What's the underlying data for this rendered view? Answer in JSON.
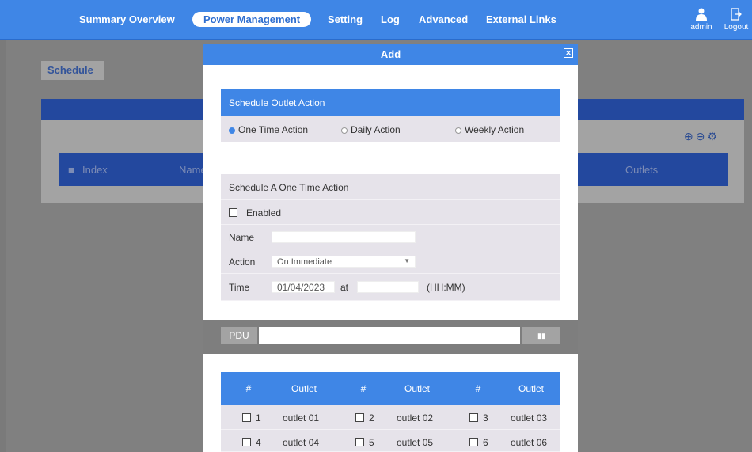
{
  "nav": {
    "items": [
      "Summary Overview",
      "Power Management",
      "Setting",
      "Log",
      "Advanced",
      "External Links"
    ],
    "active": "Power Management",
    "user_label": "admin",
    "logout_label": "Logout"
  },
  "background": {
    "tab_label": "Schedule",
    "columns": [
      "Index",
      "Name",
      "Outlets"
    ]
  },
  "modal": {
    "title": "Add",
    "section_title": "Schedule Outlet Action",
    "radios": [
      {
        "label": "One Time Action",
        "selected": true
      },
      {
        "label": "Daily Action",
        "selected": false
      },
      {
        "label": "Weekly Action",
        "selected": false
      }
    ],
    "sub_title": "Schedule A One Time Action",
    "enabled_label": "Enabled",
    "name_label": "Name",
    "name_value": "",
    "action_label": "Action",
    "action_value": "On Immediate",
    "time_label": "Time",
    "date_value": "01/04/2023",
    "at_label": "at",
    "time_value": "",
    "time_hint": "(HH:MM)",
    "pdu_label": "PDU",
    "pdu_value": "",
    "outlet_headers": [
      "#",
      "Outlet",
      "#",
      "Outlet",
      "#",
      "Outlet"
    ],
    "outlets": [
      [
        "1",
        "outlet 01",
        "2",
        "outlet 02",
        "3",
        "outlet 03"
      ],
      [
        "4",
        "outlet 04",
        "5",
        "outlet 05",
        "6",
        "outlet 06"
      ]
    ]
  },
  "colors": {
    "accent": "#3f86e6",
    "dark_header": "#23489e",
    "overlay": "#808080"
  }
}
